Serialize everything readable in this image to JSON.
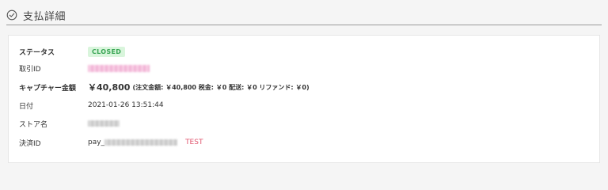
{
  "header": {
    "title": "支払詳細",
    "icon": "check-circle-icon"
  },
  "details": {
    "status": {
      "label": "ステータス",
      "value": "CLOSED"
    },
    "transaction_id": {
      "label": "取引ID"
    },
    "capture_amount": {
      "label": "キャプチャー金額",
      "amount": "￥40,800",
      "breakdown": "(注文金額: ￥40,800 税金: ￥0 配送: ￥0 リファンド: ￥0)"
    },
    "date": {
      "label": "日付",
      "value": "2021-01-26 13:51:44"
    },
    "store_name": {
      "label": "ストア名"
    },
    "payment_id": {
      "label": "決済ID",
      "prefix": "pay_",
      "tag": "TEST"
    }
  },
  "colors": {
    "status_badge_bg": "#d9f5dc",
    "status_badge_text": "#3aa655",
    "test_tag": "#e0556e"
  }
}
